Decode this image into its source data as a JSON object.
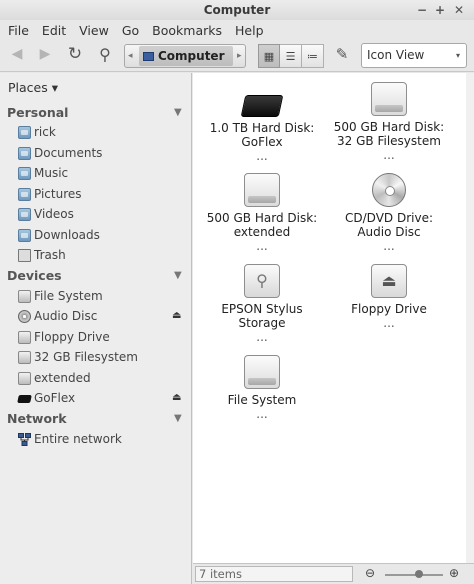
{
  "window": {
    "title": "Computer",
    "minimize_glyph": "−",
    "maximize_glyph": "+",
    "close_glyph": "✕"
  },
  "menu": [
    "File",
    "Edit",
    "View",
    "Go",
    "Bookmarks",
    "Help"
  ],
  "toolbar": {
    "back_glyph": "◀",
    "forward_glyph": "▶",
    "reload_glyph": "↻",
    "search_glyph": "⚲",
    "path_left_glyph": "◂",
    "path_right_glyph": "▸",
    "path_label": "Computer",
    "icon_view_glyph": "▦",
    "list_view_glyph": "☰",
    "compact_view_glyph": "≔",
    "edit_glyph": "✎",
    "view_mode": "Icon View",
    "view_mode_caret": "▾"
  },
  "sidebar": {
    "places_label": "Places ▾",
    "collapse_glyph": "▼",
    "eject_glyph": "⏏",
    "sections": {
      "personal": {
        "label": "Personal",
        "items": [
          "rick",
          "Documents",
          "Music",
          "Pictures",
          "Videos",
          "Downloads",
          "Trash"
        ]
      },
      "devices": {
        "label": "Devices",
        "items": [
          "File System",
          "Audio Disc",
          "Floppy Drive",
          "32 GB Filesystem",
          "extended",
          "GoFlex"
        ]
      },
      "network": {
        "label": "Network",
        "items": [
          "Entire network"
        ]
      }
    }
  },
  "files": [
    {
      "line1": "1.0 TB Hard Disk:",
      "line2": "GoFlex",
      "more": "...",
      "icon": "external-drive-icon"
    },
    {
      "line1": "500 GB Hard Disk:",
      "line2": "32 GB Filesystem",
      "more": "...",
      "icon": "hard-disk-icon"
    },
    {
      "line1": "500 GB Hard Disk:",
      "line2": "extended",
      "more": "...",
      "icon": "hard-disk-icon"
    },
    {
      "line1": "CD/DVD Drive:",
      "line2": "Audio Disc",
      "more": "...",
      "icon": "audio-cd-icon"
    },
    {
      "line1": "EPSON Stylus",
      "line2": "Storage",
      "more": "...",
      "icon": "usb-storage-icon",
      "glyph": "⚲"
    },
    {
      "line1": "Floppy Drive",
      "line2": "",
      "more": "...",
      "icon": "floppy-drive-icon",
      "glyph": "⏏"
    },
    {
      "line1": "File System",
      "line2": "",
      "more": "...",
      "icon": "hard-disk-icon"
    }
  ],
  "status": {
    "items_text": "7 items",
    "zoom_out_glyph": "⊖",
    "zoom_in_glyph": "⊕"
  }
}
